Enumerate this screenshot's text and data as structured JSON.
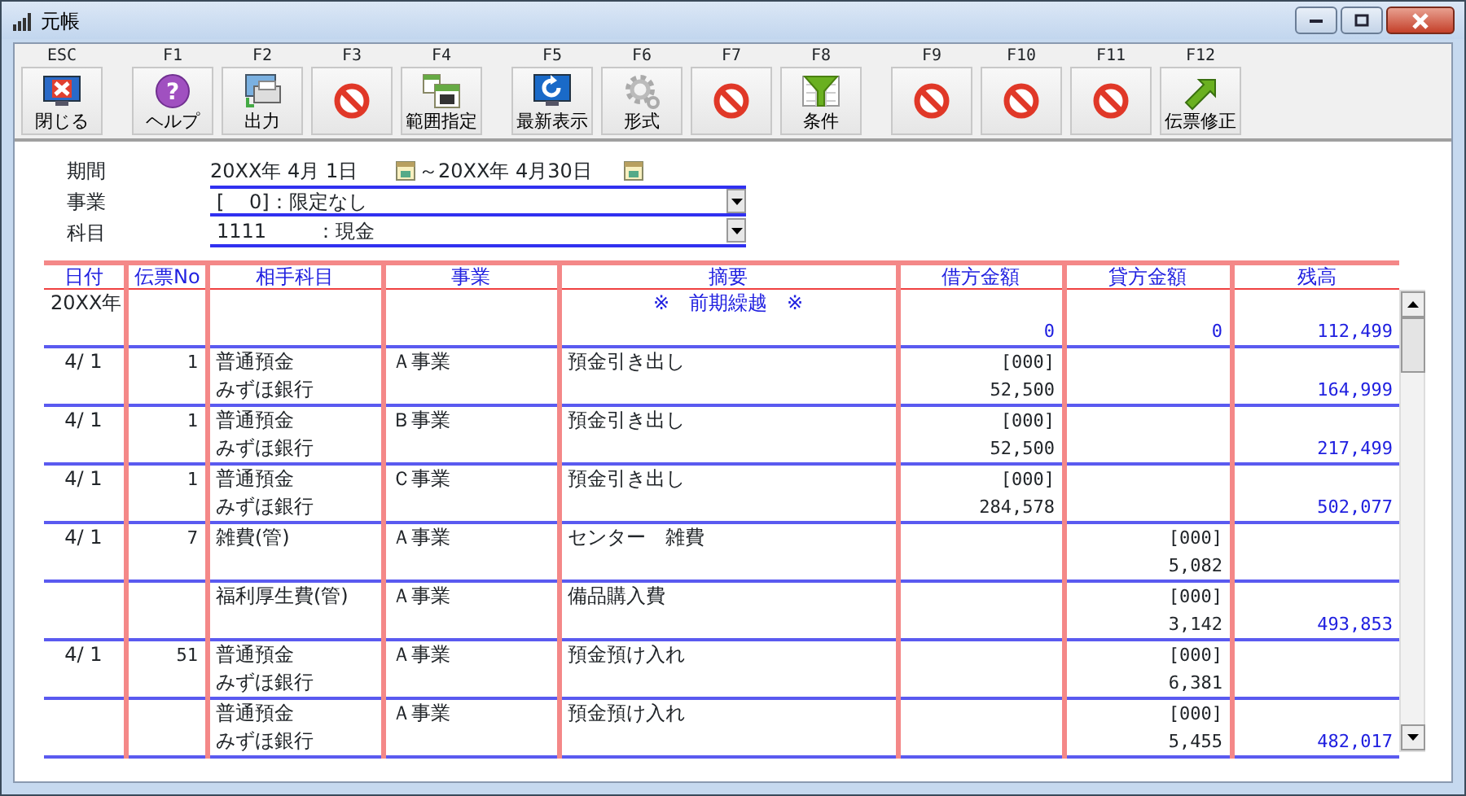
{
  "window": {
    "title": "元帳"
  },
  "toolbar": {
    "groups": [
      [
        {
          "key": "ESC",
          "label": "閉じる",
          "kind": "close"
        }
      ],
      [
        {
          "key": "F1",
          "label": "ヘルプ",
          "kind": "help",
          "glyph": "?"
        },
        {
          "key": "F2",
          "label": "出力",
          "kind": "print"
        },
        {
          "key": "F3",
          "kind": "unavailable"
        },
        {
          "key": "F4",
          "label": "範囲指定",
          "kind": "calendar"
        }
      ],
      [
        {
          "key": "F5",
          "label": "最新表示",
          "kind": "refresh"
        },
        {
          "key": "F6",
          "label": "形式",
          "kind": "settings"
        },
        {
          "key": "F7",
          "kind": "unavailable"
        },
        {
          "key": "F8",
          "label": "条件",
          "kind": "filter"
        }
      ],
      [
        {
          "key": "F9",
          "kind": "unavailable"
        },
        {
          "key": "F10",
          "kind": "unavailable"
        },
        {
          "key": "F11",
          "kind": "unavailable"
        },
        {
          "key": "F12",
          "label": "伝票修正",
          "kind": "arrow"
        }
      ]
    ]
  },
  "filters": {
    "period": {
      "label": "期間",
      "from": "20XX年 4月 1日",
      "to": "～20XX年 4月30日"
    },
    "business": {
      "label": "事業",
      "value": "[    0]：限定なし"
    },
    "account": {
      "label": "科目",
      "value": "1111        ：現金"
    }
  },
  "table": {
    "columns": [
      "日付",
      "伝票No",
      "相手科目",
      "事業",
      "摘要",
      "借方金額",
      "貸方金額",
      "残高"
    ],
    "rows": [
      {
        "kind": "carryover",
        "date": "20XX年",
        "summary": "※　前期繰越　※",
        "debit": {
          "amount": "0"
        },
        "credit": {
          "amount": "0"
        },
        "balance": "112,499"
      },
      {
        "kind": "entry",
        "date": "4/ 1",
        "no": "1",
        "account": "普通預金",
        "sub_account": "みずほ銀行",
        "business": "Ａ事業",
        "summary": "預金引き出し",
        "debit": {
          "code": "[000]",
          "amount": "52,500"
        },
        "balance": "164,999"
      },
      {
        "kind": "entry",
        "date": "4/ 1",
        "no": "1",
        "account": "普通預金",
        "sub_account": "みずほ銀行",
        "business": "Ｂ事業",
        "summary": "預金引き出し",
        "debit": {
          "code": "[000]",
          "amount": "52,500"
        },
        "balance": "217,499"
      },
      {
        "kind": "entry",
        "date": "4/ 1",
        "no": "1",
        "account": "普通預金",
        "sub_account": "みずほ銀行",
        "business": "Ｃ事業",
        "summary": "預金引き出し",
        "debit": {
          "code": "[000]",
          "amount": "284,578"
        },
        "balance": "502,077"
      },
      {
        "kind": "entry",
        "date": "4/ 1",
        "no": "7",
        "account": "雑費(管)",
        "business": "Ａ事業",
        "summary": "センター　雑費",
        "credit": {
          "code": "[000]",
          "amount": "5,082"
        }
      },
      {
        "kind": "entry",
        "account": "福利厚生費(管)",
        "business": "Ａ事業",
        "summary": "備品購入費",
        "credit": {
          "code": "[000]",
          "amount": "3,142"
        },
        "balance": "493,853"
      },
      {
        "kind": "entry",
        "date": "4/ 1",
        "no": "51",
        "account": "普通預金",
        "sub_account": "みずほ銀行",
        "business": "Ａ事業",
        "summary": "預金預け入れ",
        "credit": {
          "code": "[000]",
          "amount": "6,381"
        }
      },
      {
        "kind": "entry",
        "account": "普通預金",
        "sub_account": "みずほ銀行",
        "business": "Ａ事業",
        "summary": "預金預け入れ",
        "credit": {
          "code": "[000]",
          "amount": "5,455"
        },
        "balance": "482,017"
      }
    ]
  }
}
